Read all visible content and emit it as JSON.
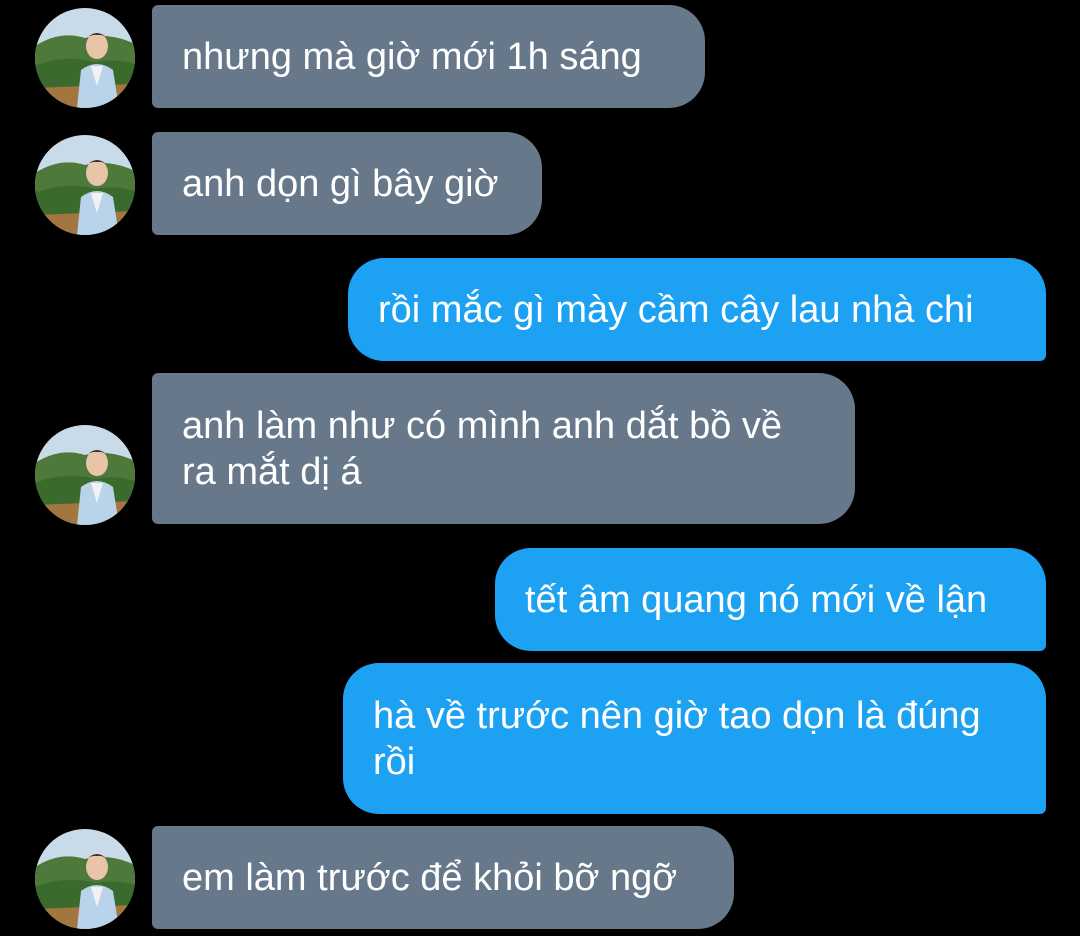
{
  "conversation": {
    "messages": [
      {
        "sender": "them",
        "text": "nhưng mà giờ mới 1h sáng"
      },
      {
        "sender": "them",
        "text": "anh dọn gì bây giờ"
      },
      {
        "sender": "me",
        "text": "rồi mắc gì mày cầm cây lau nhà chi"
      },
      {
        "sender": "them",
        "text": "anh làm như có mình anh dắt bồ về\nra mắt dị á"
      },
      {
        "sender": "me",
        "text": "tết âm quang nó mới về lận"
      },
      {
        "sender": "me",
        "text": "hà về trước nên giờ tao dọn là đúng\nrồi"
      },
      {
        "sender": "them",
        "text": "em làm trước để khỏi bỡ ngỡ"
      }
    ]
  },
  "colors": {
    "background": "#000000",
    "incoming_bubble": "#66788a",
    "outgoing_bubble": "#1da1f2",
    "text": "#ffffff"
  },
  "icons": {
    "contact_avatar": "contact-avatar-photo"
  }
}
